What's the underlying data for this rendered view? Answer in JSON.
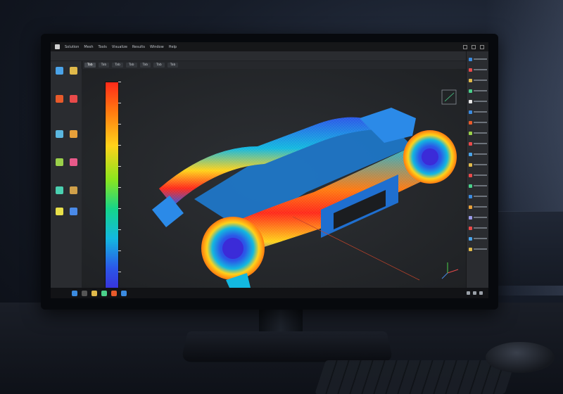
{
  "app": {
    "menu_items": [
      "Solution",
      "Mesh",
      "Tools",
      "Visualize",
      "Results",
      "Window",
      "Help"
    ],
    "toolbar_path": "",
    "tabs": [
      {
        "label": "Tab",
        "active": true
      },
      {
        "label": "Tab",
        "active": false
      },
      {
        "label": "Tab",
        "active": false
      },
      {
        "label": "Tab",
        "active": false
      },
      {
        "label": "Tab",
        "active": false
      },
      {
        "label": "Tab",
        "active": false
      },
      {
        "label": "Tab",
        "active": false
      }
    ]
  },
  "legend": {
    "title": "",
    "colors": [
      "#ff2a1a",
      "#ff7a10",
      "#ffd21a",
      "#8be51e",
      "#15d48a",
      "#13b8e0",
      "#2b57e8",
      "#3b2bd8"
    ]
  },
  "left_tools": [
    {
      "icon": "cube-icon",
      "label": "",
      "color": "#4aa3e8"
    },
    {
      "icon": "wrench-icon",
      "label": "",
      "color": "#e0b94a"
    },
    {
      "icon": "lightning-icon",
      "label": "",
      "color": "#e85a2a"
    },
    {
      "icon": "target-icon",
      "label": "",
      "color": "#e84a4a"
    },
    {
      "icon": "grid-icon",
      "label": "",
      "color": "#5bb7e0"
    },
    {
      "icon": "shield-icon",
      "label": "",
      "color": "#e8a03a"
    },
    {
      "icon": "gear-icon",
      "label": "",
      "color": "#9ad04a"
    },
    {
      "icon": "layers-icon",
      "label": "",
      "color": "#e85a8a"
    },
    {
      "icon": "chart-icon",
      "label": "",
      "color": "#4ad0b0"
    },
    {
      "icon": "flag-icon",
      "label": "",
      "color": "#d0a04a"
    },
    {
      "icon": "palette-icon",
      "label": "",
      "color": "#e8e04a"
    },
    {
      "icon": "probe-icon",
      "label": "",
      "color": "#4a8ae8"
    }
  ],
  "right_panel_colors": [
    "#3b8be0",
    "#e84a4a",
    "#e0b94a",
    "#4ad08a",
    "#e8e8e8",
    "#3b8be0",
    "#e85a2a",
    "#9ad04a",
    "#e84a4a",
    "#4aa3e8",
    "#e0b94a",
    "#e84a4a",
    "#4ad08a",
    "#3b8be0",
    "#e8a03a",
    "#9a9ae8",
    "#e84a4a",
    "#4aa3e8",
    "#e0b94a"
  ]
}
